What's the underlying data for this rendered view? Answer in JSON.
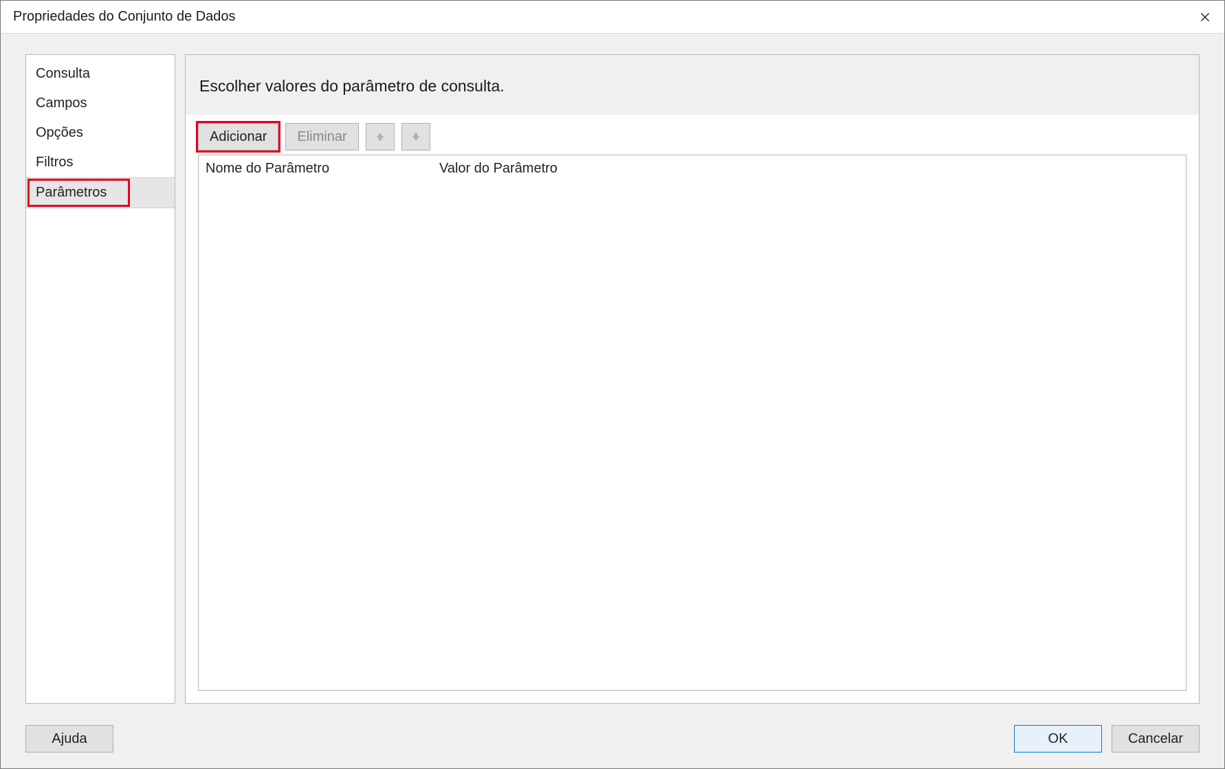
{
  "window": {
    "title": "Propriedades do Conjunto de Dados"
  },
  "sidebar": {
    "items": [
      {
        "label": "Consulta",
        "selected": false,
        "highlighted": false
      },
      {
        "label": "Campos",
        "selected": false,
        "highlighted": false
      },
      {
        "label": "Opções",
        "selected": false,
        "highlighted": false
      },
      {
        "label": "Filtros",
        "selected": false,
        "highlighted": false
      },
      {
        "label": "Parâmetros",
        "selected": true,
        "highlighted": true
      }
    ]
  },
  "main": {
    "heading": "Escolher valores do parâmetro de consulta.",
    "toolbar": {
      "add_label": "Adicionar",
      "delete_label": "Eliminar",
      "move_up_name": "move-up-icon",
      "move_down_name": "move-down-icon"
    },
    "grid": {
      "columns": {
        "name_label": "Nome do Parâmetro",
        "value_label": "Valor do Parâmetro"
      },
      "rows": []
    }
  },
  "footer": {
    "help_label": "Ajuda",
    "ok_label": "OK",
    "cancel_label": "Cancelar"
  }
}
